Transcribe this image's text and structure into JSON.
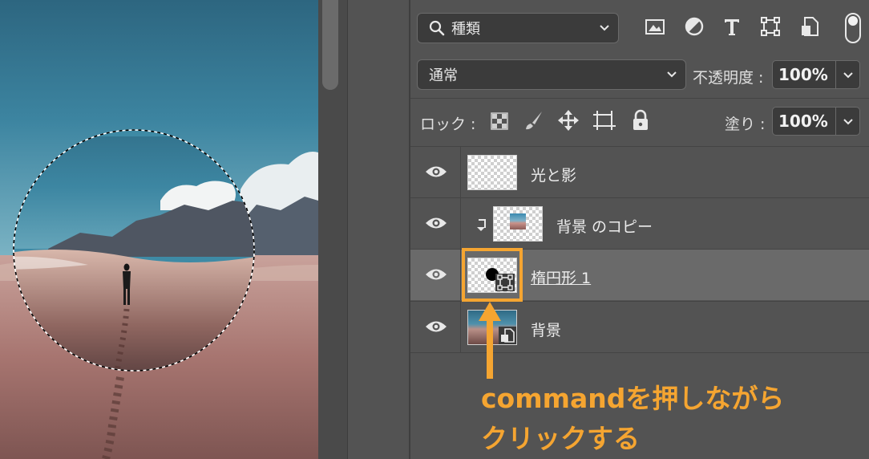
{
  "panel": {
    "filter": {
      "label": "種類"
    },
    "blend_mode": {
      "value": "通常"
    },
    "opacity": {
      "label": "不透明度 :",
      "value": "100%"
    },
    "lock": {
      "label": "ロック :"
    },
    "fill": {
      "label": "塗り :",
      "value": "100%"
    },
    "filter_icons": [
      "image-filter-icon",
      "adjustment-filter-icon",
      "type-filter-icon",
      "shape-filter-icon",
      "smart-object-filter-icon"
    ],
    "lock_icons": [
      "lock-transparent-icon",
      "lock-paint-icon",
      "lock-position-icon",
      "lock-artboard-icon",
      "lock-all-icon"
    ]
  },
  "layers": [
    {
      "name": "光と影",
      "visible": true,
      "selected": false,
      "clipped": false,
      "kind": "empty"
    },
    {
      "name": "背景 のコピー",
      "visible": true,
      "selected": false,
      "clipped": true,
      "kind": "image"
    },
    {
      "name": "楕円形 1",
      "visible": true,
      "selected": true,
      "clipped": false,
      "kind": "shape"
    },
    {
      "name": "背景",
      "visible": true,
      "selected": false,
      "clipped": false,
      "kind": "smart-object"
    }
  ],
  "annotation": {
    "line1": "commandを押しながら",
    "line2": "クリックする",
    "color": "#f5a531"
  },
  "colors": {
    "panel_bg": "#535353",
    "field_bg": "#3b3b3b",
    "selected_row": "#6a6a6a",
    "accent": "#f5a531"
  }
}
